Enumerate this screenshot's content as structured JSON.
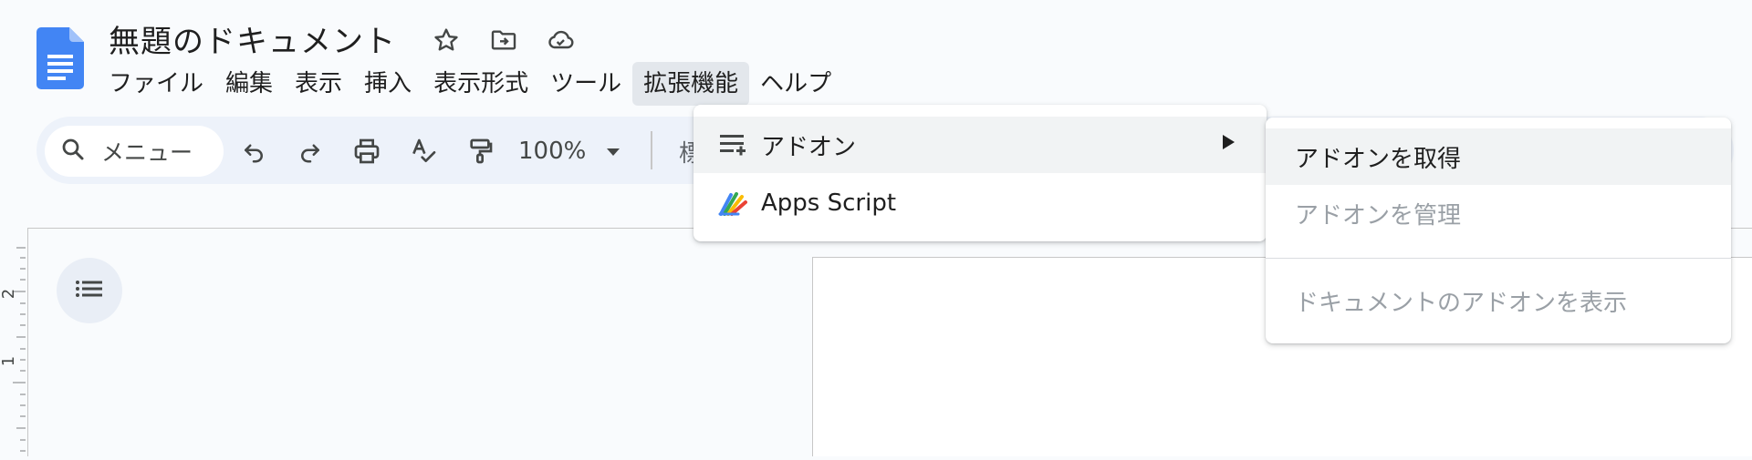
{
  "document": {
    "title": "無題のドキュメント"
  },
  "menubar": {
    "items": [
      {
        "label": "ファイル"
      },
      {
        "label": "編集"
      },
      {
        "label": "表示"
      },
      {
        "label": "挿入"
      },
      {
        "label": "表示形式"
      },
      {
        "label": "ツール"
      },
      {
        "label": "拡張機能",
        "active": true
      },
      {
        "label": "ヘルプ"
      }
    ]
  },
  "toolbar": {
    "search_placeholder": "メニュー",
    "zoom": "100%",
    "style_partial": "標"
  },
  "extensions_menu": {
    "items": [
      {
        "label": "アドオン",
        "icon": "addons-icon",
        "has_submenu": true
      },
      {
        "label": "Apps Script",
        "icon": "apps-script-icon"
      }
    ]
  },
  "addons_submenu": {
    "items": [
      {
        "label": "アドオンを取得",
        "enabled": true
      },
      {
        "label": "アドオンを管理",
        "enabled": false
      },
      {
        "label": "ドキュメントのアドオンを表示",
        "enabled": false
      }
    ]
  },
  "ruler": {
    "labels": [
      "2",
      "1"
    ]
  },
  "colors": {
    "doc_blue": "#4285f4",
    "toolbar_bg": "#edf2fa",
    "menu_active_bg": "#e3e7ec",
    "disabled_text": "#9aa0a6"
  }
}
